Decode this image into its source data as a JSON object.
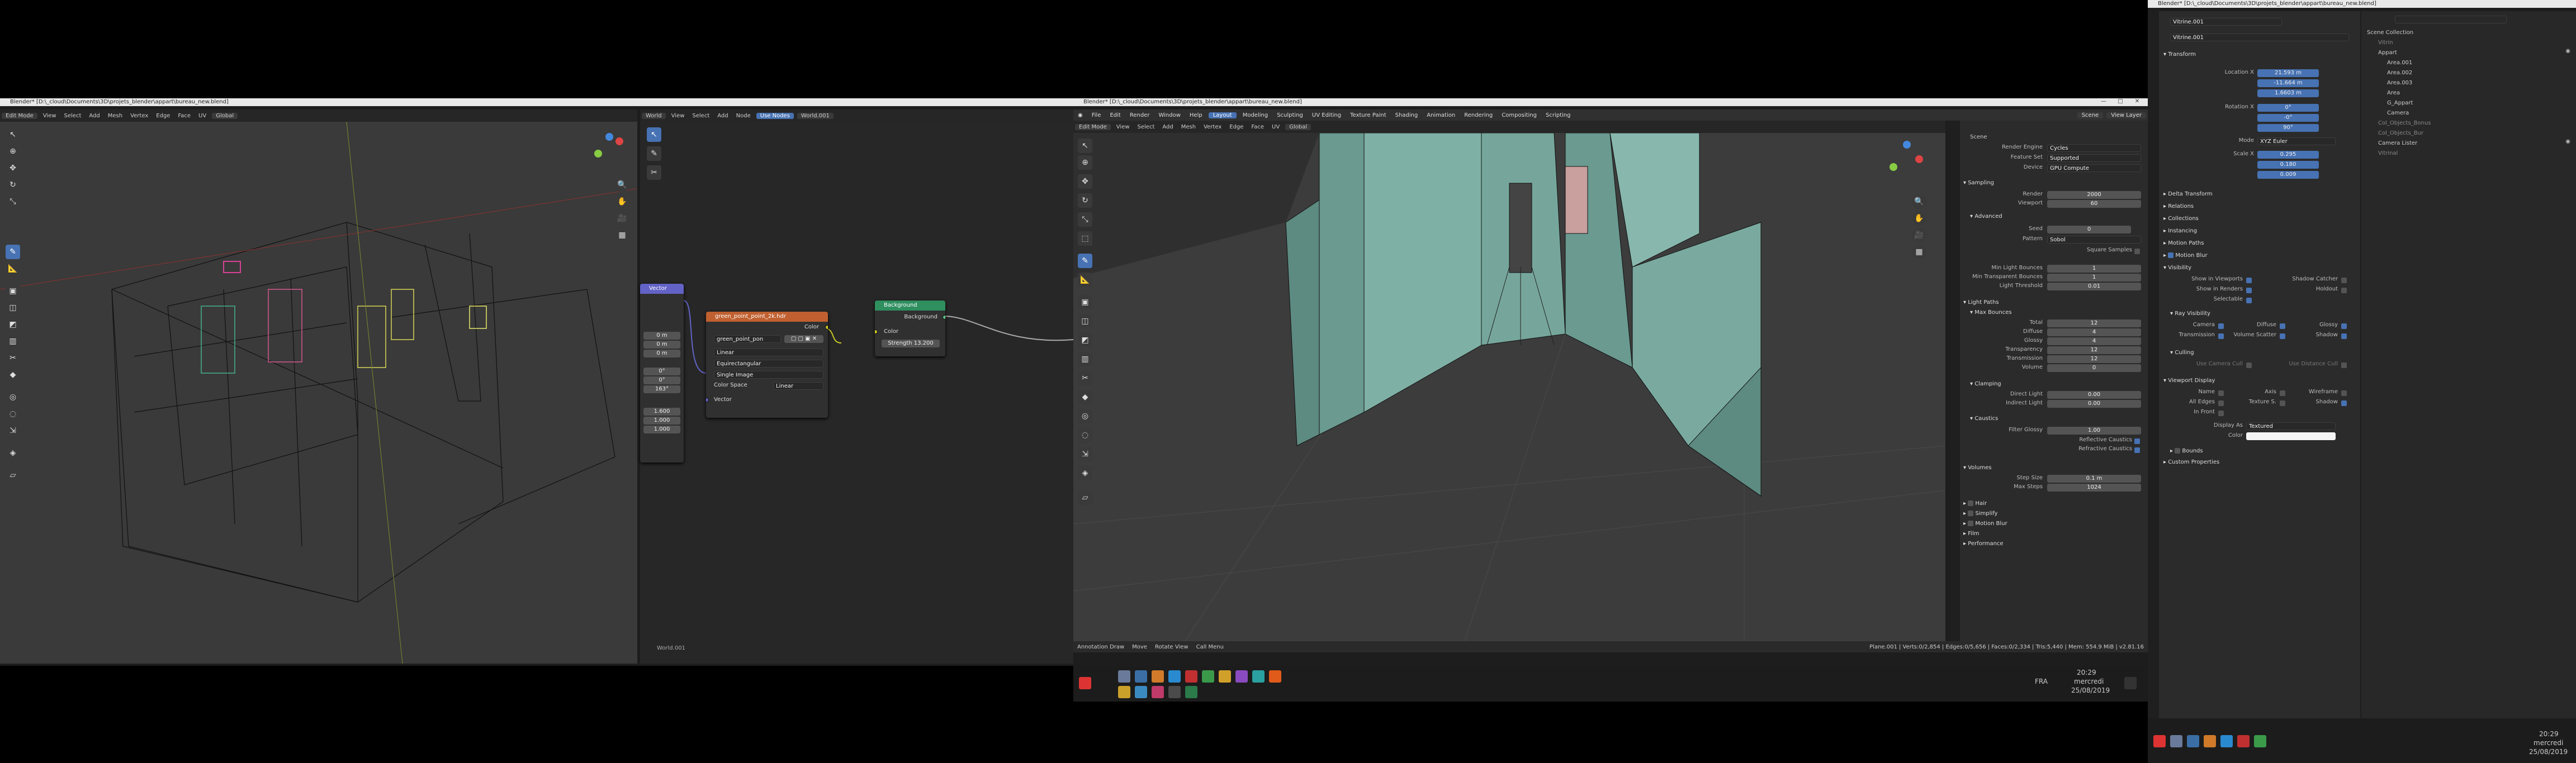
{
  "left_window": {
    "title": "Blender* [D:\\_cloud\\Documents\\3D\\projets_blender\\appart\\bureau_new.blend]",
    "viewport_header": {
      "mode": "Edit Mode",
      "menus": [
        "View",
        "Select",
        "Add",
        "Mesh",
        "Vertex",
        "Edge",
        "Face",
        "UV"
      ],
      "transform": "Global"
    },
    "node_header": {
      "type": "World",
      "menus": [
        "View",
        "Select",
        "Add",
        "Node"
      ],
      "use_nodes": "Use Nodes",
      "slot": "World.001"
    },
    "nodes": {
      "mapping_header": "Vector",
      "tex_header": "green_point_point_2k.hdr",
      "tex_image": "green_point_pon",
      "tex_color": "Color",
      "tex_options": [
        "Linear",
        "Equirectangular",
        "Single Image"
      ],
      "tex_colorspace_label": "Color Space",
      "tex_colorspace": "Linear",
      "tex_vector": "Vector",
      "bg_header": "Background",
      "bg_out": "Background",
      "bg_color": "Color",
      "bg_strength_label": "Strength",
      "bg_strength": "13.200",
      "map_values": [
        "0 m",
        "0 m",
        "0 m",
        "0°",
        "0°",
        "163°",
        "1.600",
        "1.000",
        "1.000"
      ]
    },
    "node_footer": "World.001"
  },
  "center_window": {
    "title": "Blender* [D:\\_cloud\\Documents\\3D\\projets_blender\\appart\\bureau_new.blend]",
    "menus": [
      "File",
      "Edit",
      "Render",
      "Window",
      "Help"
    ],
    "workspaces": [
      "Layout",
      "Modeling",
      "Sculpting",
      "UV Editing",
      "Texture Paint",
      "Shading",
      "Animation",
      "Rendering",
      "Compositing",
      "Scripting"
    ],
    "header": {
      "mode": "Edit Mode",
      "menus": [
        "View",
        "Select",
        "Add",
        "Mesh",
        "Vertex",
        "Edge",
        "Face",
        "UV"
      ],
      "transform": "Global",
      "scene": "Scene",
      "view_layer": "View Layer"
    },
    "render_props": {
      "scene_label": "Scene",
      "render_engine_label": "Render Engine",
      "render_engine": "Cycles",
      "feature_set_label": "Feature Set",
      "feature_set": "Supported",
      "device_label": "Device",
      "device": "GPU Compute",
      "sampling": "Sampling",
      "render_label": "Render",
      "render_val": "2000",
      "viewport_label": "Viewport",
      "viewport_val": "60",
      "advanced": "Advanced",
      "seed_label": "Seed",
      "seed_val": "0",
      "pattern_label": "Pattern",
      "pattern_val": "Sobol",
      "square_samples": "Square Samples",
      "min_bounces_label": "Min Light Bounces",
      "min_bounces_val": "1",
      "min_trans_label": "Min Transparent Bounces",
      "min_trans_val": "1",
      "light_threshold_label": "Light Threshold",
      "light_threshold_val": "0.01",
      "light_paths": "Light Paths",
      "max_bounces": "Max Bounces",
      "bounce_rows": [
        [
          "Total",
          "12"
        ],
        [
          "Diffuse",
          "4"
        ],
        [
          "Glossy",
          "4"
        ],
        [
          "Transparency",
          "12"
        ],
        [
          "Transmission",
          "12"
        ],
        [
          "Volume",
          "0"
        ]
      ],
      "clamping": "Clamping",
      "direct_label": "Direct Light",
      "direct_val": "0.00",
      "indirect_label": "Indirect Light",
      "indirect_val": "0.00",
      "caustics": "Caustics",
      "filter_glossy_label": "Filter Glossy",
      "filter_glossy_val": "1.00",
      "refl_caustics": "Reflective Caustics",
      "refr_caustics": "Refractive Caustics",
      "volumes": "Volumes",
      "step_label": "Step Size",
      "step_val": "0.1 m",
      "max_steps_label": "Max Steps",
      "max_steps_val": "1024",
      "collapsed": [
        "Hair",
        "Simplify",
        "Motion Blur",
        "Film",
        "Performance"
      ]
    },
    "status": {
      "left": [
        "Annotation Draw",
        "Move",
        "Rotate View",
        "Call Menu"
      ],
      "right": "Plane.001 | Verts:0/2,854 | Edges:0/5,656 | Faces:0/2,334 | Tris:5,440 | Mem: 554.9 MiB | v2.81.16"
    },
    "tray": {
      "lang": "FRA",
      "time": "20:29",
      "date": "25/08/2019",
      "day": "mercredi"
    }
  },
  "right_window": {
    "title": "Blender* [D:\\_cloud\\Documents\\3D\\projets_blender\\appart\\bureau_new.blend]",
    "object_name": "Vitrine.001",
    "object_field": "Vitrine.001",
    "transform": "Transform",
    "location_label": "Location X",
    "loc": [
      "21.593 m",
      "-11.664 m",
      "1.6603 m"
    ],
    "rotation_label": "Rotation X",
    "rot": [
      "0°",
      "-0°",
      "90°"
    ],
    "mode_label": "Mode",
    "mode": "XYZ Euler",
    "scale_label": "Scale X",
    "scale": [
      "0.295",
      "0.180",
      "0.009"
    ],
    "panels": [
      "Delta Transform",
      "Relations",
      "Collections",
      "Instancing",
      "Motion Paths"
    ],
    "motion_blur": "Motion Blur",
    "visibility": "Visibility",
    "vis_rows": [
      [
        "Show in Viewports",
        "Shadow Catcher"
      ],
      [
        "Show in Renders",
        "Holdout"
      ],
      [
        "Selectable",
        ""
      ]
    ],
    "ray_visibility": "Ray Visibility",
    "ray_rows": [
      [
        "Camera",
        "Diffuse",
        "Glossy"
      ],
      [
        "Transmission",
        "Volume Scatter",
        "Shadow"
      ]
    ],
    "culling": "Culling",
    "use_camera_cull": "Use Camera Cull",
    "use_distance_cull": "Use Distance Cull",
    "viewport_display": "Viewport Display",
    "vd_rows": [
      [
        "Name",
        "Axis",
        "Wireframe"
      ],
      [
        "All Edges",
        "Texture S.",
        "Shadow"
      ],
      [
        "In Front",
        "",
        ""
      ]
    ],
    "display_as_label": "Display As",
    "display_as": "Textured",
    "color_label": "Color",
    "bounds": "Bounds",
    "custom_props": "Custom Properties",
    "outliner": {
      "root": "Scene Collection",
      "items": [
        "Vitrin",
        "Appart",
        "Area.001",
        "Area.002",
        "Area.003",
        "Area",
        "G_Appart",
        "Camera",
        "Col_Objects_Bonus",
        "Col_Objects_Bur",
        "Camera Lister",
        "Vitrinal"
      ]
    },
    "tray": {
      "time": "20:29",
      "date": "25/08/2019",
      "day": "mercredi"
    }
  }
}
